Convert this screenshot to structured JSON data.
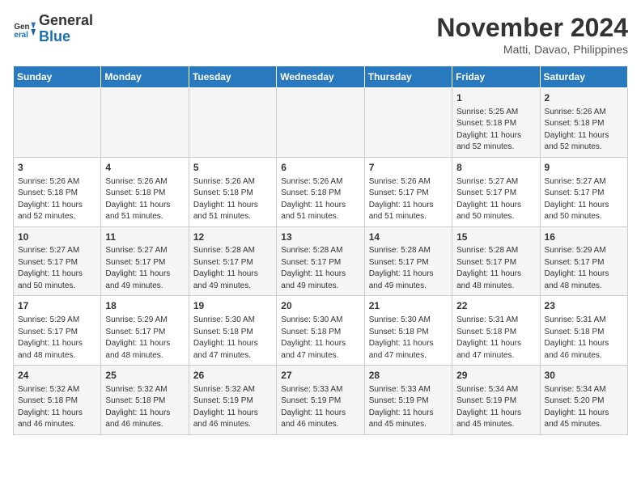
{
  "header": {
    "logo_line1": "General",
    "logo_line2": "Blue",
    "month": "November 2024",
    "location": "Matti, Davao, Philippines"
  },
  "days_of_week": [
    "Sunday",
    "Monday",
    "Tuesday",
    "Wednesday",
    "Thursday",
    "Friday",
    "Saturday"
  ],
  "weeks": [
    [
      {
        "day": "",
        "info": ""
      },
      {
        "day": "",
        "info": ""
      },
      {
        "day": "",
        "info": ""
      },
      {
        "day": "",
        "info": ""
      },
      {
        "day": "",
        "info": ""
      },
      {
        "day": "1",
        "info": "Sunrise: 5:25 AM\nSunset: 5:18 PM\nDaylight: 11 hours and 52 minutes."
      },
      {
        "day": "2",
        "info": "Sunrise: 5:26 AM\nSunset: 5:18 PM\nDaylight: 11 hours and 52 minutes."
      }
    ],
    [
      {
        "day": "3",
        "info": "Sunrise: 5:26 AM\nSunset: 5:18 PM\nDaylight: 11 hours and 52 minutes."
      },
      {
        "day": "4",
        "info": "Sunrise: 5:26 AM\nSunset: 5:18 PM\nDaylight: 11 hours and 51 minutes."
      },
      {
        "day": "5",
        "info": "Sunrise: 5:26 AM\nSunset: 5:18 PM\nDaylight: 11 hours and 51 minutes."
      },
      {
        "day": "6",
        "info": "Sunrise: 5:26 AM\nSunset: 5:18 PM\nDaylight: 11 hours and 51 minutes."
      },
      {
        "day": "7",
        "info": "Sunrise: 5:26 AM\nSunset: 5:17 PM\nDaylight: 11 hours and 51 minutes."
      },
      {
        "day": "8",
        "info": "Sunrise: 5:27 AM\nSunset: 5:17 PM\nDaylight: 11 hours and 50 minutes."
      },
      {
        "day": "9",
        "info": "Sunrise: 5:27 AM\nSunset: 5:17 PM\nDaylight: 11 hours and 50 minutes."
      }
    ],
    [
      {
        "day": "10",
        "info": "Sunrise: 5:27 AM\nSunset: 5:17 PM\nDaylight: 11 hours and 50 minutes."
      },
      {
        "day": "11",
        "info": "Sunrise: 5:27 AM\nSunset: 5:17 PM\nDaylight: 11 hours and 49 minutes."
      },
      {
        "day": "12",
        "info": "Sunrise: 5:28 AM\nSunset: 5:17 PM\nDaylight: 11 hours and 49 minutes."
      },
      {
        "day": "13",
        "info": "Sunrise: 5:28 AM\nSunset: 5:17 PM\nDaylight: 11 hours and 49 minutes."
      },
      {
        "day": "14",
        "info": "Sunrise: 5:28 AM\nSunset: 5:17 PM\nDaylight: 11 hours and 49 minutes."
      },
      {
        "day": "15",
        "info": "Sunrise: 5:28 AM\nSunset: 5:17 PM\nDaylight: 11 hours and 48 minutes."
      },
      {
        "day": "16",
        "info": "Sunrise: 5:29 AM\nSunset: 5:17 PM\nDaylight: 11 hours and 48 minutes."
      }
    ],
    [
      {
        "day": "17",
        "info": "Sunrise: 5:29 AM\nSunset: 5:17 PM\nDaylight: 11 hours and 48 minutes."
      },
      {
        "day": "18",
        "info": "Sunrise: 5:29 AM\nSunset: 5:17 PM\nDaylight: 11 hours and 48 minutes."
      },
      {
        "day": "19",
        "info": "Sunrise: 5:30 AM\nSunset: 5:18 PM\nDaylight: 11 hours and 47 minutes."
      },
      {
        "day": "20",
        "info": "Sunrise: 5:30 AM\nSunset: 5:18 PM\nDaylight: 11 hours and 47 minutes."
      },
      {
        "day": "21",
        "info": "Sunrise: 5:30 AM\nSunset: 5:18 PM\nDaylight: 11 hours and 47 minutes."
      },
      {
        "day": "22",
        "info": "Sunrise: 5:31 AM\nSunset: 5:18 PM\nDaylight: 11 hours and 47 minutes."
      },
      {
        "day": "23",
        "info": "Sunrise: 5:31 AM\nSunset: 5:18 PM\nDaylight: 11 hours and 46 minutes."
      }
    ],
    [
      {
        "day": "24",
        "info": "Sunrise: 5:32 AM\nSunset: 5:18 PM\nDaylight: 11 hours and 46 minutes."
      },
      {
        "day": "25",
        "info": "Sunrise: 5:32 AM\nSunset: 5:18 PM\nDaylight: 11 hours and 46 minutes."
      },
      {
        "day": "26",
        "info": "Sunrise: 5:32 AM\nSunset: 5:19 PM\nDaylight: 11 hours and 46 minutes."
      },
      {
        "day": "27",
        "info": "Sunrise: 5:33 AM\nSunset: 5:19 PM\nDaylight: 11 hours and 46 minutes."
      },
      {
        "day": "28",
        "info": "Sunrise: 5:33 AM\nSunset: 5:19 PM\nDaylight: 11 hours and 45 minutes."
      },
      {
        "day": "29",
        "info": "Sunrise: 5:34 AM\nSunset: 5:19 PM\nDaylight: 11 hours and 45 minutes."
      },
      {
        "day": "30",
        "info": "Sunrise: 5:34 AM\nSunset: 5:20 PM\nDaylight: 11 hours and 45 minutes."
      }
    ]
  ]
}
